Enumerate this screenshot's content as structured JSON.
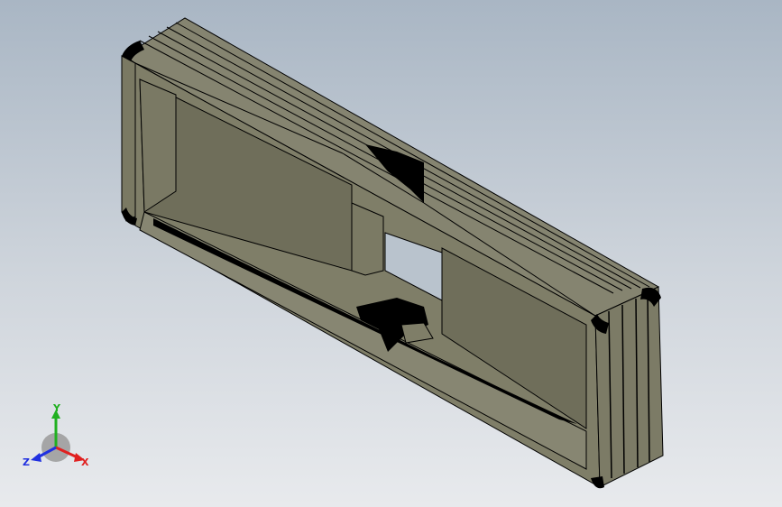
{
  "viewport": {
    "background_top": "#a9b6c4",
    "background_bottom": "#e8eaed"
  },
  "model": {
    "face_color": "#7f7e68",
    "face_shadow": "#6f6e5a",
    "face_dark": "#5f5e4c",
    "edge_color": "#000000"
  },
  "triad": {
    "x_label": "X",
    "y_label": "Y",
    "z_label": "Z",
    "x_color": "#e02020",
    "y_color": "#20b020",
    "z_color": "#2030e0"
  }
}
